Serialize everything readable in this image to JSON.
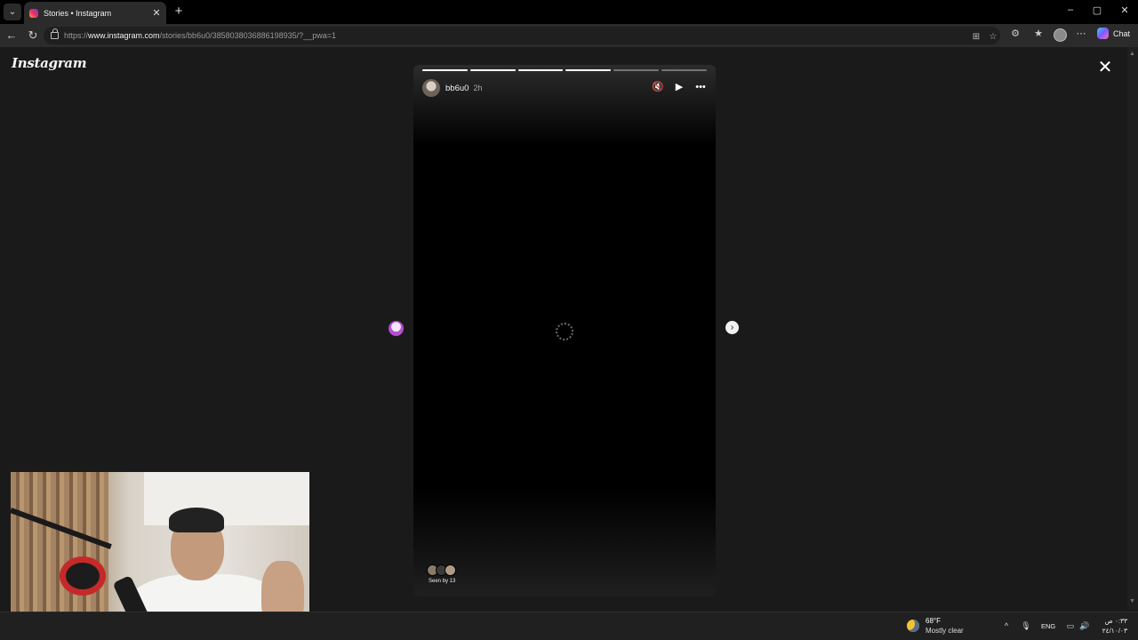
{
  "browser": {
    "tab_title": "Stories • Instagram",
    "tab_close": "✕",
    "new_tab": "+",
    "tab_list": "⌄",
    "window": {
      "minimize": "–",
      "maximize": "▢",
      "close": "✕"
    },
    "url_scheme": "https://",
    "url_host": "www.instagram.com",
    "url_path": "/stories/bb6u0/3858038036886198935/?__pwa=1",
    "copilot_label": "Chat"
  },
  "page": {
    "logo": "Instagram",
    "close_icon": "✕",
    "story": {
      "username": "bb6u0",
      "time": "2h",
      "segments": [
        1,
        1,
        1,
        1,
        0,
        0
      ],
      "seen_by": "Seen by 13",
      "controls": {
        "mute": "🔇",
        "play": "▶",
        "more": "•••"
      }
    },
    "next_icon": "›"
  },
  "taskbar": {
    "weather_temp": "68°F",
    "weather_desc": "Mostly clear",
    "language": "ENG",
    "time": "٠:٣٣ ص",
    "date": "٢٤/١٠/٠٣"
  },
  "colors": {
    "accent": "#e1306c",
    "background": "#1a1a1a",
    "story_bg": "#000000"
  }
}
